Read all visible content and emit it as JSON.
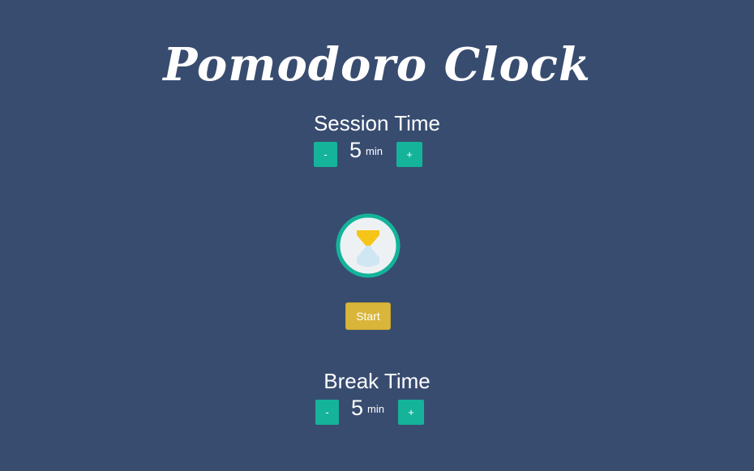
{
  "app": {
    "title": "Pomodoro Clock"
  },
  "session": {
    "label": "Session Time",
    "minus_label": "-",
    "value": "5",
    "unit": "min",
    "plus_label": "+"
  },
  "timer": {
    "icon": "hourglass-icon",
    "start_label": "Start"
  },
  "break": {
    "label": "Break Time",
    "minus_label": "-",
    "value": "5",
    "unit": "min",
    "plus_label": "+"
  },
  "colors": {
    "background": "#384c70",
    "accent": "#14b39a",
    "start": "#d9b53a",
    "sand": "#f5c518"
  }
}
